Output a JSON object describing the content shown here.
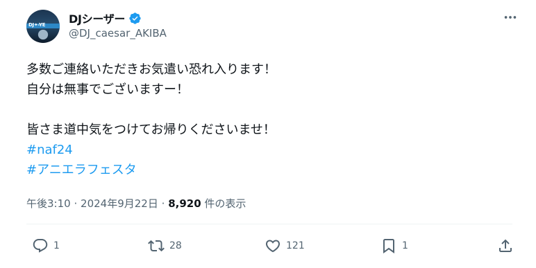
{
  "user": {
    "display_name": "DJシーザー",
    "handle": "@DJ_caesar_AKIBA",
    "avatar_tag": "DJ✦-YE",
    "verified": true
  },
  "tweet": {
    "lines": [
      "多数ご連絡いただきお気遣い恐れ入ります！",
      "自分は無事でございますー！",
      "",
      "皆さま道中気をつけてお帰りくださいませ！"
    ],
    "hashtags": [
      "#naf24",
      "#アニエラフェスタ"
    ]
  },
  "meta": {
    "time": "午後3:10",
    "separator": "·",
    "date": "2024年9月22日",
    "views": "8,920",
    "views_label": "件の表示"
  },
  "actions": {
    "replies": "1",
    "reposts": "28",
    "likes": "121",
    "bookmarks": "1"
  },
  "icons": {
    "more": "more-dots-icon",
    "verified": "verified-badge-icon",
    "reply": "reply-icon",
    "repost": "repost-icon",
    "like": "like-icon",
    "bookmark": "bookmark-icon",
    "share": "share-icon"
  },
  "colors": {
    "text": "#0f1419",
    "secondary": "#536471",
    "accent": "#1d9bf0",
    "divider": "#eff3f4"
  }
}
